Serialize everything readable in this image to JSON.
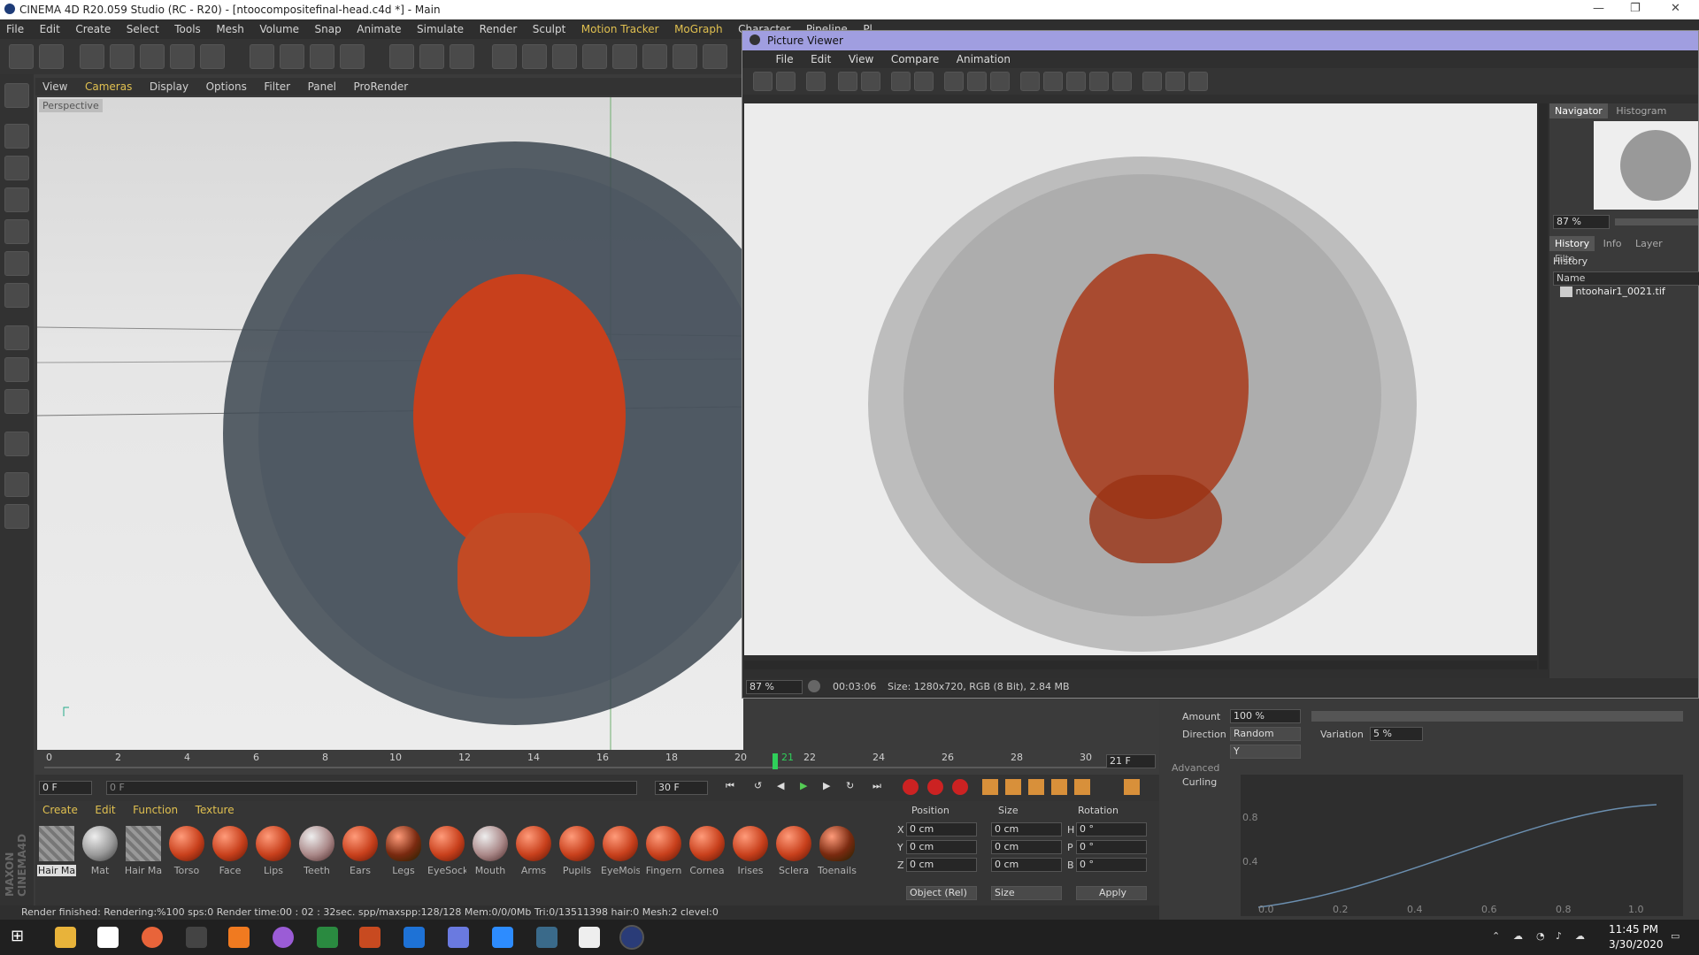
{
  "window": {
    "title": "CINEMA 4D R20.059 Studio (RC - R20) - [ntoocompositefinal-head.c4d *] - Main"
  },
  "main_menu": [
    "File",
    "Edit",
    "Create",
    "Select",
    "Tools",
    "Mesh",
    "Volume",
    "Snap",
    "Animate",
    "Simulate",
    "Render",
    "Sculpt",
    "Motion Tracker",
    "MoGraph",
    "Character",
    "Pipeline",
    "Pl"
  ],
  "viewport": {
    "menu": [
      "View",
      "Cameras",
      "Display",
      "Options",
      "Filter",
      "Panel",
      "ProRender"
    ],
    "label": "Perspective"
  },
  "timeline": {
    "ticks": [
      "0",
      "2",
      "4",
      "6",
      "8",
      "10",
      "12",
      "14",
      "16",
      "18",
      "20",
      "22",
      "24",
      "26",
      "28",
      "30"
    ],
    "current_frame_marker": "21",
    "frame_field": "21 F",
    "start_field": "0 F",
    "range_start": "0 F",
    "range_end": "30 F",
    "end_field": "30 F"
  },
  "material_manager": {
    "menu": [
      "Create",
      "Edit",
      "Function",
      "Texture"
    ],
    "materials": [
      "Hair Ma",
      "Mat",
      "Hair Ma",
      "Torso",
      "Face",
      "Lips",
      "Teeth",
      "Ears",
      "Legs",
      "EyeSock",
      "Mouth",
      "Arms",
      "Pupils",
      "EyeMois",
      "Fingern",
      "Cornea",
      "Irises",
      "Sclera",
      "Toenails"
    ]
  },
  "coordinates": {
    "headers": [
      "Position",
      "Size",
      "Rotation"
    ],
    "rows": [
      {
        "axis": "X",
        "pos": "0 cm",
        "size": "0 cm",
        "rot_axis": "H",
        "rot": "0 °"
      },
      {
        "axis": "Y",
        "pos": "0 cm",
        "size": "0 cm",
        "rot_axis": "P",
        "rot": "0 °"
      },
      {
        "axis": "Z",
        "pos": "0 cm",
        "size": "0 cm",
        "rot_axis": "B",
        "rot": "0 °"
      }
    ],
    "mode": "Object (Rel)",
    "size_mode": "Size",
    "apply": "Apply"
  },
  "status": {
    "text": "Render finished: Rendering:%100 sps:0 Render time:00 : 02 : 32sec. spp/maxspp:128/128 Mem:0/0/0Mb Tri:0/13511398 hair:0 Mesh:2 clevel:0"
  },
  "picture_viewer": {
    "title": "Picture Viewer",
    "menu": [
      "File",
      "Edit",
      "View",
      "Compare",
      "Animation"
    ],
    "zoom": "87 %",
    "time": "00:03:06",
    "size_info": "Size: 1280x720, RGB (8 Bit), 2.84 MB",
    "nav_tabs": [
      "Navigator",
      "Histogram"
    ],
    "nav_zoom": "87 %",
    "hist_tabs": [
      "History",
      "Info",
      "Layer",
      "Filte"
    ],
    "history_label": "History",
    "history_col": "Name",
    "history_item": "ntoohair1_0021.tif"
  },
  "attributes": {
    "amount_label": "Amount",
    "amount_value": "100 %",
    "direction_label": "Direction",
    "direction_value": "Random",
    "variation_label": "Variation",
    "variation_value": "5 %",
    "axis_value": "Y",
    "advanced_label": "Advanced",
    "curling_label": "Curling",
    "graph_y": [
      "0.8",
      "0.4"
    ],
    "graph_x": [
      "0.0",
      "0.2",
      "0.4",
      "0.6",
      "0.8",
      "1.0"
    ]
  },
  "taskbar": {
    "time": "11:45 PM",
    "date": "3/30/2020"
  },
  "colors": {
    "accent": "#e0c050",
    "pv_title": "#a09ee0",
    "skin": "#c8401c",
    "timeline_marker": "#2fcf5a"
  }
}
